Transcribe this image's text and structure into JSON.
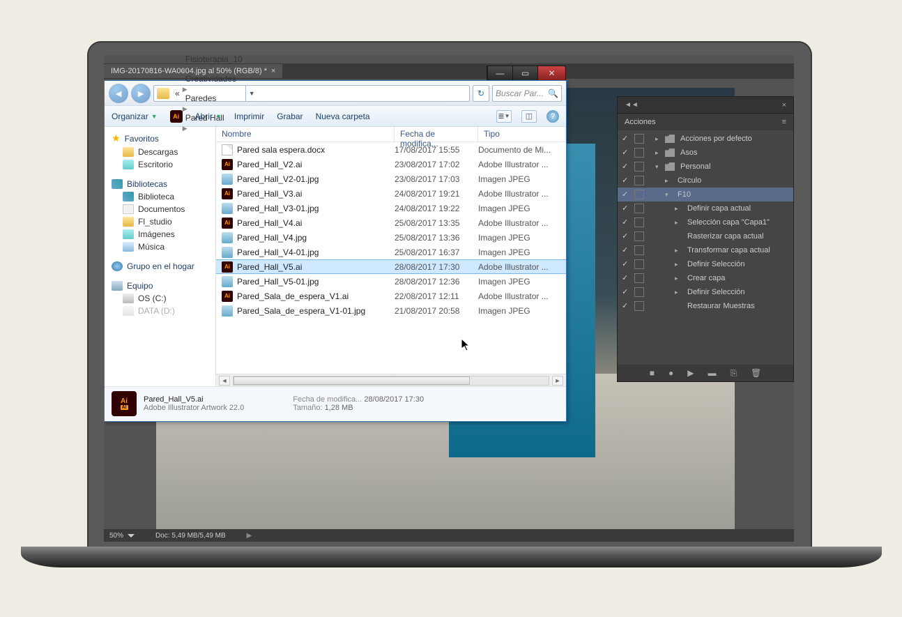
{
  "ps": {
    "tab_title": "IMG-20170816-WA0004.jpg al 50% (RGB/8) *",
    "zoom": "50%",
    "doc_size": "Doc: 5,49 MB/5,49 MB"
  },
  "actions_panel": {
    "title": "Acciones",
    "items": [
      {
        "label": "Acciones por defecto",
        "depth": 0,
        "folder": true,
        "arrow": ">"
      },
      {
        "label": "Asos",
        "depth": 0,
        "folder": true,
        "arrow": ">"
      },
      {
        "label": "Personal",
        "depth": 0,
        "folder": true,
        "arrow": "v"
      },
      {
        "label": "Circulo",
        "depth": 1,
        "arrow": ">"
      },
      {
        "label": "F10",
        "depth": 1,
        "arrow": "v",
        "selected": true
      },
      {
        "label": "Definir capa actual",
        "depth": 2,
        "arrow": ">"
      },
      {
        "label": "Selección capa \"Capa1\"",
        "depth": 2,
        "arrow": ">"
      },
      {
        "label": "Rasterizar capa actual",
        "depth": 2,
        "arrow": ""
      },
      {
        "label": "Transformar capa actual",
        "depth": 2,
        "arrow": ">"
      },
      {
        "label": "Definir Selección",
        "depth": 2,
        "arrow": ">"
      },
      {
        "label": "Crear capa",
        "depth": 2,
        "arrow": ">"
      },
      {
        "label": "Definir Selección",
        "depth": 2,
        "arrow": ">"
      },
      {
        "label": "Restaurar Muestras",
        "depth": 2,
        "arrow": ""
      }
    ]
  },
  "explorer": {
    "breadcrumb": [
      "Fisioterapia_10",
      "Creatividades",
      "Paredes",
      "Pared Hall"
    ],
    "search_placeholder": "Buscar Par...",
    "toolbar": {
      "organize": "Organizar",
      "open": "Abrir",
      "print": "Imprimir",
      "burn": "Grabar",
      "new_folder": "Nueva carpeta"
    },
    "sidebar": {
      "favoritos": "Favoritos",
      "descargas": "Descargas",
      "escritorio": "Escritorio",
      "bibliotecas": "Bibliotecas",
      "biblioteca": "Biblioteca",
      "documentos": "Documentos",
      "fl_studio": "Fl_studio",
      "imagenes": "Imágenes",
      "musica": "Música",
      "hogar": "Grupo en el hogar",
      "equipo": "Equipo",
      "os_c": "OS (C:)",
      "data_d": "DATA (D:)"
    },
    "columns": {
      "name": "Nombre",
      "date": "Fecha de modifica...",
      "type": "Tipo"
    },
    "files": [
      {
        "icon": "doc",
        "name": "Pared sala espera.docx",
        "date": "17/08/2017 15:55",
        "type": "Documento de Mi..."
      },
      {
        "icon": "ai",
        "name": "Pared_Hall_V2.ai",
        "date": "23/08/2017 17:02",
        "type": "Adobe Illustrator ..."
      },
      {
        "icon": "jpg",
        "name": "Pared_Hall_V2-01.jpg",
        "date": "23/08/2017 17:03",
        "type": "Imagen JPEG"
      },
      {
        "icon": "ai",
        "name": "Pared_Hall_V3.ai",
        "date": "24/08/2017 19:21",
        "type": "Adobe Illustrator ..."
      },
      {
        "icon": "jpg",
        "name": "Pared_Hall_V3-01.jpg",
        "date": "24/08/2017 19:22",
        "type": "Imagen JPEG"
      },
      {
        "icon": "ai",
        "name": "Pared_Hall_V4.ai",
        "date": "25/08/2017 13:35",
        "type": "Adobe Illustrator ..."
      },
      {
        "icon": "jpg",
        "name": "Pared_Hall_V4.jpg",
        "date": "25/08/2017 13:36",
        "type": "Imagen JPEG"
      },
      {
        "icon": "jpg",
        "name": "Pared_Hall_V4-01.jpg",
        "date": "25/08/2017 16:37",
        "type": "Imagen JPEG"
      },
      {
        "icon": "ai",
        "name": "Pared_Hall_V5.ai",
        "date": "28/08/2017 17:30",
        "type": "Adobe Illustrator ...",
        "selected": true
      },
      {
        "icon": "jpg",
        "name": "Pared_Hall_V5-01.jpg",
        "date": "28/08/2017 12:36",
        "type": "Imagen JPEG"
      },
      {
        "icon": "ai",
        "name": "Pared_Sala_de_espera_V1.ai",
        "date": "22/08/2017 12:11",
        "type": "Adobe Illustrator ..."
      },
      {
        "icon": "jpg",
        "name": "Pared_Sala_de_espera_V1-01.jpg",
        "date": "21/08/2017 20:58",
        "type": "Imagen JPEG"
      }
    ],
    "details": {
      "filename": "Pared_Hall_V5.ai",
      "filetype": "Adobe Illustrator Artwork 22.0",
      "mod_label": "Fecha de modifica...",
      "mod_value": "28/08/2017 17:30",
      "size_label": "Tamaño:",
      "size_value": "1,28 MB",
      "thumb_top": "Ai",
      "thumb_bot": "AI"
    }
  }
}
